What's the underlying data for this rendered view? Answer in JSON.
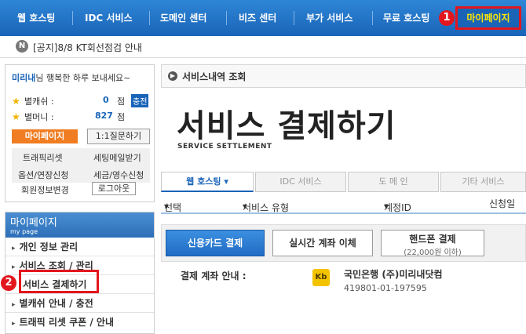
{
  "topnav": {
    "items": [
      "웹 호스팅",
      "IDC 서비스",
      "도메인 센터",
      "비즈 센터",
      "부가 서비스",
      "무료 호스팅"
    ],
    "mypage": "마이페이지"
  },
  "callouts": {
    "one": "1",
    "two": "2"
  },
  "notice": {
    "icon": "N",
    "text": "[공지]8/8 KT회선점검 안내"
  },
  "user": {
    "name": "미리내",
    "greeting": "님 행복한 하루 보내세요~",
    "cash_label": "별캐쉬 :",
    "cash_value": "0",
    "cash_unit": "점",
    "charge": "충전",
    "money_label": "별머니 :",
    "money_value": "827",
    "money_unit": "점",
    "mypage_btn": "마이페이지",
    "qna_btn": "1:1질문하기",
    "links": [
      "트래픽리셋",
      "세팅메일받기",
      "옵션/연장신청",
      "세금/영수신청"
    ],
    "profile": "회원정보변경",
    "logout": "로그아웃"
  },
  "mymenu": {
    "title": "마이페이지",
    "subtitle": "my page",
    "items": [
      "개인 정보 관리",
      "서비스 조회 / 관리",
      "서비스 결제하기",
      "별캐쉬 안내 / 충전",
      "트래픽 리셋 쿠폰 / 안내"
    ]
  },
  "main": {
    "breadcrumb": "서비스내역 조회",
    "title": "서비스 결제하기",
    "subtitle": "SERVICE SETTLEMENT",
    "tabs": [
      "웹 호스팅",
      "IDC 서비스",
      "도 메 인",
      "기타 서비스"
    ],
    "columns": [
      "선택",
      "서비스 유형",
      "계정ID",
      "신청일"
    ],
    "pay_card": "신용카드 결제",
    "pay_transfer": "실시간 계좌 이체",
    "pay_phone": "핸드폰 결제",
    "pay_phone_note": "(22,000원 이하)",
    "account_label": "결제 계좌 안내 :",
    "bank_logo": "Kb",
    "bank": "국민은행 (주)미리내닷컴",
    "account_no": "419801-01-197595"
  },
  "colors": {
    "accent": "#1a64b8",
    "highlight": "#e3161e",
    "orange": "#f07d22"
  }
}
